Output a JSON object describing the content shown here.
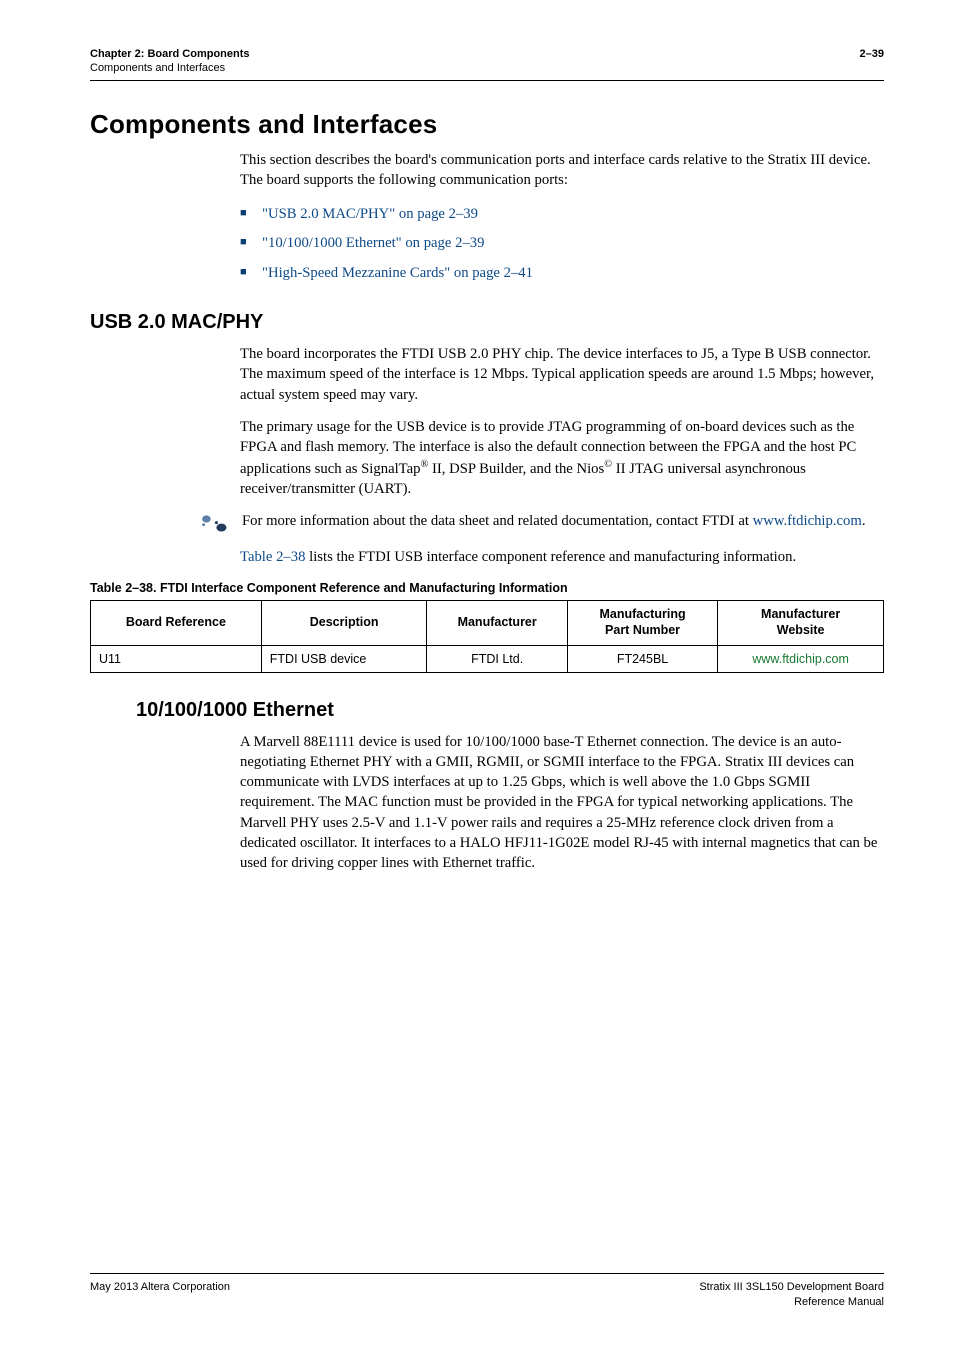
{
  "header": {
    "chapter": "Chapter 2: Board Components",
    "sub": "Components and Interfaces",
    "page": "2–39"
  },
  "section": {
    "title": "Components and Interfaces",
    "intro": "This section describes the board's communication ports and interface cards relative to the Stratix III device. The board supports the following communication ports:",
    "bullets": [
      "\"USB 2.0 MAC/PHY\" on page 2–39",
      "\"10/100/1000 Ethernet\" on page 2–39",
      "\"High-Speed Mezzanine Cards\" on page 2–41"
    ]
  },
  "usb": {
    "title": "USB 2.0 MAC/PHY",
    "p1": "The board incorporates the FTDI USB 2.0 PHY chip. The device interfaces to J5, a Type B USB connector. The maximum speed of the interface is 12 Mbps. Typical application speeds are around 1.5 Mbps; however, actual system speed may vary.",
    "p2_a": "The primary usage for the USB device is to provide JTAG programming of on-board devices such as the FPGA and flash memory. The interface is also the default connection between the FPGA and the host PC applications such as SignalTap",
    "p2_b": " II, DSP Builder, and the Nios",
    "p2_c": " II JTAG universal asynchronous receiver/transmitter (UART).",
    "note_a": "For more information about the data sheet and related documentation, contact FTDI at ",
    "note_link": "www.ftdichip.com",
    "note_b": ".",
    "ref_a": "Table 2–38",
    "ref_b": " lists the FTDI USB interface component reference and manufacturing information."
  },
  "table": {
    "caption": "Table 2–38.  FTDI Interface Component Reference and Manufacturing Information",
    "headers": {
      "ref": "Board Reference",
      "desc": "Description",
      "mfr": "Manufacturer",
      "part": "Manufacturing\nPart Number",
      "site": "Manufacturer\nWebsite"
    },
    "row": {
      "ref": "U11",
      "desc": "FTDI USB device",
      "mfr": "FTDI Ltd.",
      "part": "FT245BL",
      "site": "www.ftdichip.com"
    }
  },
  "eth": {
    "title": "10/100/1000 Ethernet",
    "p1": "A Marvell 88E1111 device is used for 10/100/1000 base-T Ethernet connection. The device is an auto-negotiating Ethernet PHY with a GMII, RGMII, or SGMII interface to the FPGA. Stratix III devices can communicate with LVDS interfaces at up to 1.25 Gbps, which is well above the 1.0 Gbps SGMII requirement. The MAC function must be provided in the FPGA for typical networking applications. The Marvell PHY uses 2.5-V and 1.1-V power rails and requires a 25-MHz reference clock driven from a dedicated oscillator. It interfaces to a HALO HFJ11-1G02E model RJ-45 with internal magnetics that can be used for driving copper lines with Ethernet traffic."
  },
  "footer": {
    "left": "May 2013   Altera Corporation",
    "right1": "Stratix III 3SL150 Development Board",
    "right2": "Reference Manual"
  }
}
